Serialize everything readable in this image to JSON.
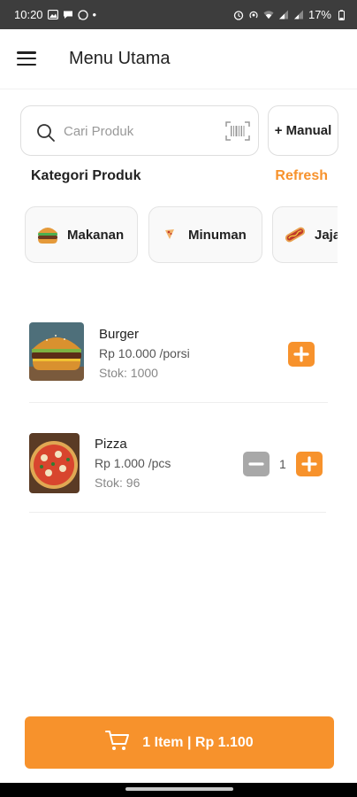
{
  "status_bar": {
    "time": "10:20",
    "battery": "17%",
    "dot": "•"
  },
  "app_bar": {
    "title": "Menu Utama",
    "menu_icon": "hamburger-menu-icon"
  },
  "search": {
    "placeholder": "Cari Produk",
    "value": "",
    "search_icon": "search-icon",
    "barcode_icon": "barcode-scan-icon"
  },
  "manual_button": {
    "label": "+ Manual"
  },
  "categories_section": {
    "title": "Kategori Produk",
    "refresh_label": "Refresh",
    "items": [
      {
        "label": "Makanan",
        "icon": "burger-icon"
      },
      {
        "label": "Minuman",
        "icon": "drink-icon"
      },
      {
        "label": "Jajanan",
        "icon": "hotdog-icon"
      }
    ]
  },
  "products": [
    {
      "name": "Burger",
      "price": "Rp 10.000 /porsi",
      "stock": "Stok: 1000",
      "quantity": null
    },
    {
      "name": "Pizza",
      "price": "Rp 1.000 /pcs",
      "stock": "Stok: 96",
      "quantity": "1"
    }
  ],
  "checkout": {
    "label": "1 Item | Rp 1.100",
    "icon": "cart-icon"
  },
  "colors": {
    "accent": "#f7922c",
    "status_bar": "#3d3d3d",
    "minus_button": "#a8a8a8"
  }
}
